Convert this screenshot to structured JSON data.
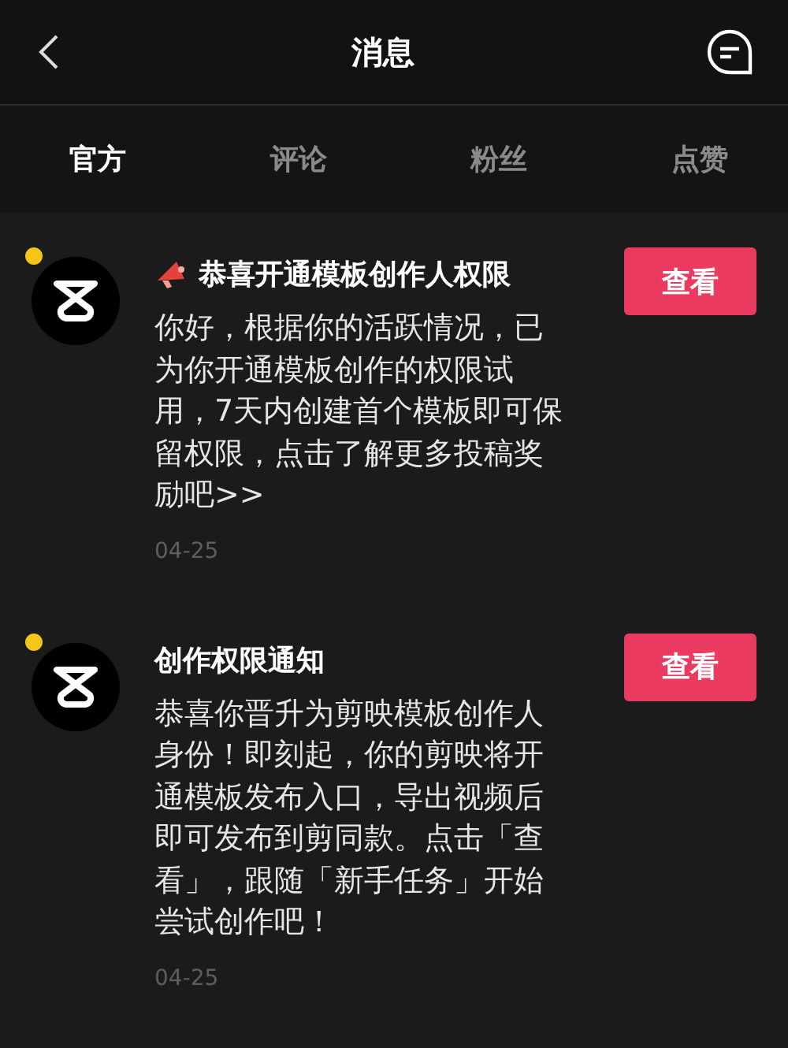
{
  "header": {
    "title": "消息"
  },
  "tabs": [
    {
      "label": "官方",
      "selected": true
    },
    {
      "label": "评论",
      "selected": false
    },
    {
      "label": "粉丝",
      "selected": false
    },
    {
      "label": "点赞",
      "selected": false
    }
  ],
  "messages": [
    {
      "unread": true,
      "has_icon": true,
      "title": "恭喜开通模板创作人权限",
      "body": "你好，根据你的活跃情况，已为你开通模板创作的权限试用，7天内创建首个模板即可保留权限，点击了解更多投稿奖励吧>>",
      "date": "04-25",
      "button": "查看"
    },
    {
      "unread": true,
      "has_icon": false,
      "title": "创作权限通知",
      "body": "恭喜你晋升为剪映模板创作人身份！即刻起，你的剪映将开通模板发布入口，导出视频后即可发布到剪同款。点击「查看」，跟随「新手任务」开始尝试创作吧！",
      "date": "04-25",
      "button": "查看"
    }
  ]
}
